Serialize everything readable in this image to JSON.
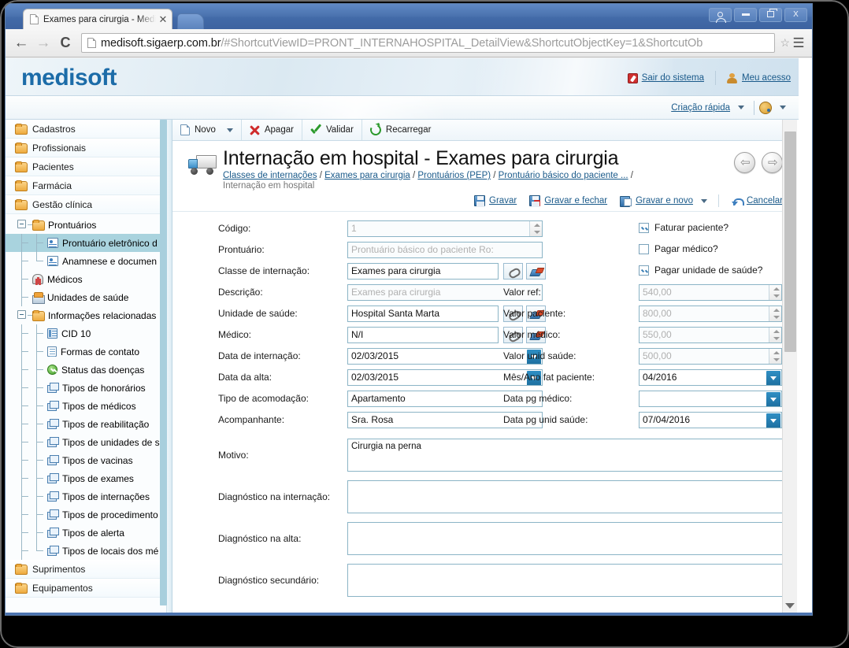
{
  "browser": {
    "tab_title": "Exames para cirurgia - Medis",
    "tab_close": "✕",
    "back": "←",
    "forward": "→",
    "reload": "C",
    "url_host": "medisoft.sigaerp.com.br",
    "url_path": "/#ShortcutViewID=PRONT_INTERNAHOSPITAL_DetailView&ShortcutObjectKey=1&ShortcutOb",
    "star": "☆",
    "menu": "☰",
    "win_close": "X"
  },
  "header": {
    "logo": "medisoft",
    "logout_label": "Sair do sistema",
    "myaccess_label": "Meu acesso",
    "quick_create_label": "Criação rápida"
  },
  "sidebar": {
    "roots": [
      {
        "label": "Cadastros"
      },
      {
        "label": "Profissionais"
      },
      {
        "label": "Pacientes"
      },
      {
        "label": "Farmácia"
      },
      {
        "label": "Gestão clínica"
      }
    ],
    "tree": [
      {
        "label": "Prontuários",
        "icon": "folder",
        "level": 1,
        "expander": true
      },
      {
        "label": "Prontuário eletrônico d",
        "icon": "card",
        "level": 2,
        "selected": true
      },
      {
        "label": "Anamnese e documen",
        "icon": "card",
        "level": 2,
        "last": true
      },
      {
        "label": "Médicos",
        "icon": "doctor",
        "level": 1
      },
      {
        "label": "Unidades de saúde",
        "icon": "hospital",
        "level": 1
      },
      {
        "label": "Informações relacionadas",
        "icon": "folder",
        "level": 1,
        "expander": true
      },
      {
        "label": "CID 10",
        "icon": "doc2",
        "level": 2
      },
      {
        "label": "Formas de contato",
        "icon": "doc",
        "level": 2
      },
      {
        "label": "Status das doenças",
        "icon": "check",
        "level": 2
      },
      {
        "label": "Tipos de honorários",
        "icon": "stack",
        "level": 2
      },
      {
        "label": "Tipos de médicos",
        "icon": "stack",
        "level": 2
      },
      {
        "label": "Tipos de reabilitação",
        "icon": "stack",
        "level": 2
      },
      {
        "label": "Tipos de unidades de s",
        "icon": "stack",
        "level": 2
      },
      {
        "label": "Tipos de vacinas",
        "icon": "stack",
        "level": 2
      },
      {
        "label": "Tipos de exames",
        "icon": "stack",
        "level": 2
      },
      {
        "label": "Tipos de internações",
        "icon": "stack",
        "level": 2
      },
      {
        "label": "Tipos de procedimento",
        "icon": "stack",
        "level": 2
      },
      {
        "label": "Tipos de alerta",
        "icon": "stack",
        "level": 2
      },
      {
        "label": "Tipos de locais dos mé",
        "icon": "stack",
        "level": 2,
        "last": true
      }
    ],
    "roots_bottom": [
      {
        "label": "Suprimentos"
      },
      {
        "label": "Equipamentos"
      }
    ]
  },
  "commandbar": {
    "new_label": "Novo",
    "delete_label": "Apagar",
    "validate_label": "Validar",
    "reload_label": "Recarregar"
  },
  "record": {
    "title": "Internação em hospital - Exames para cirurgia",
    "subtitle": "Internação em hospital",
    "breadcrumb": [
      "Classes de internações",
      "Exames para cirurgia",
      "Prontuários (PEP)",
      "Prontuário básico do paciente ..."
    ],
    "breadcrumb_sep": "/",
    "actions": {
      "save": "Gravar",
      "save_close": "Gravar e fechar",
      "save_new": "Gravar e novo",
      "cancel": "Cancelar"
    }
  },
  "form": {
    "left": [
      {
        "label": "Código:",
        "value": "1",
        "type": "spin",
        "readonly": true
      },
      {
        "label": "Prontuário:",
        "value": "Prontuário básico do paciente Ro:",
        "type": "text",
        "readonly": true
      },
      {
        "label": "Classe de internação:",
        "value": "Exames para cirurgia",
        "type": "lookup"
      },
      {
        "label": "Descrição:",
        "value": "Exames para cirurgia",
        "type": "text",
        "readonly": true
      },
      {
        "label": "Unidade de saúde:",
        "value": "Hospital Santa Marta",
        "type": "lookup"
      },
      {
        "label": "Médico:",
        "value": "N/I",
        "type": "lookup"
      },
      {
        "label": "Data de internação:",
        "value": "02/03/2015",
        "type": "date"
      },
      {
        "label": "Data da alta:",
        "value": "02/03/2015",
        "type": "date"
      },
      {
        "label": "Tipo de acomodação:",
        "value": "Apartamento",
        "type": "text"
      },
      {
        "label": "Acompanhante:",
        "value": "Sra. Rosa",
        "type": "text"
      }
    ],
    "checkboxes": [
      {
        "label": "Faturar paciente?",
        "checked": true
      },
      {
        "label": "Pagar médico?",
        "checked": false
      },
      {
        "label": "Pagar unidade de saúde?",
        "checked": true
      }
    ],
    "right": [
      {
        "label": "Valor ref:",
        "value": "540,00",
        "type": "spin",
        "readonly": true
      },
      {
        "label": "Valor paciente:",
        "value": "800,00",
        "type": "spin",
        "readonly": true
      },
      {
        "label": "Valor médico:",
        "value": "550,00",
        "type": "spin",
        "readonly": true
      },
      {
        "label": "Valor unid saúde:",
        "value": "500,00",
        "type": "spin",
        "readonly": true
      },
      {
        "label": "Mês/Ano fat paciente:",
        "value": "04/2016",
        "type": "date"
      },
      {
        "label": "Data pg médico:",
        "value": "",
        "type": "date"
      },
      {
        "label": "Data pg unid saúde:",
        "value": "07/04/2016",
        "type": "date"
      }
    ],
    "areas": [
      {
        "label": "Motivo:",
        "value": "Cirurgia na perna"
      },
      {
        "label": "Diagnóstico na internação:",
        "value": ""
      },
      {
        "label": "Diagnóstico na alta:",
        "value": ""
      },
      {
        "label": "Diagnóstico secundário:",
        "value": ""
      }
    ]
  }
}
